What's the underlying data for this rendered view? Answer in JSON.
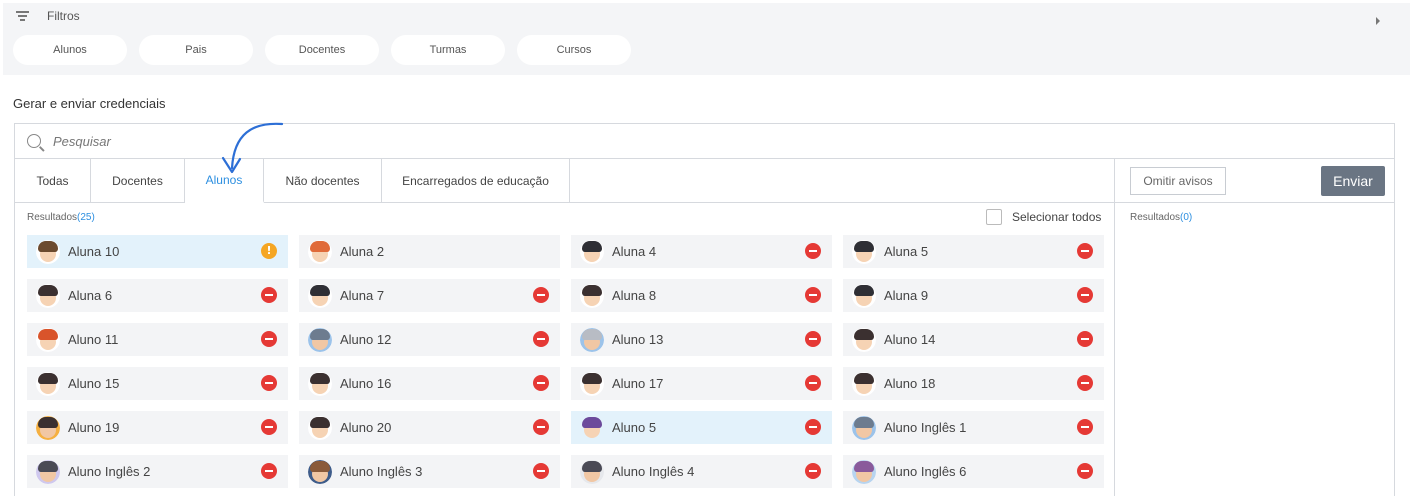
{
  "filters": {
    "title": "Filtros",
    "pills": [
      "Alunos",
      "Pais",
      "Docentes",
      "Turmas",
      "Cursos"
    ]
  },
  "section_title": "Gerar e enviar credenciais",
  "search": {
    "placeholder": "Pesquisar"
  },
  "tabs": [
    "Todas",
    "Docentes",
    "Alunos",
    "Não docentes",
    "Encarregados de educação"
  ],
  "active_tab": "Alunos",
  "left": {
    "results_label": "Resultados",
    "results_count": "(25)",
    "select_all_label": "Selecionar todos"
  },
  "right": {
    "omit_label": "Omitir avisos",
    "send_label": "Enviar",
    "results_label": "Resultados",
    "results_count": "(0)"
  },
  "accent_color": "#2d8fe0",
  "people": [
    {
      "name": "Aluna 10",
      "status": "warning",
      "highlight": true,
      "avatar": "boy-brown"
    },
    {
      "name": "Aluna 2",
      "status": "none",
      "highlight": false,
      "avatar": "girl-orange"
    },
    {
      "name": "Aluna 4",
      "status": "blocked",
      "highlight": false,
      "avatar": "girl-dark"
    },
    {
      "name": "Aluna 5",
      "status": "blocked",
      "highlight": false,
      "avatar": "girl-dark"
    },
    {
      "name": "Aluna 6",
      "status": "blocked",
      "highlight": false,
      "avatar": "boy-dark"
    },
    {
      "name": "Aluna 7",
      "status": "blocked",
      "highlight": false,
      "avatar": "girl-dark"
    },
    {
      "name": "Aluna 8",
      "status": "blocked",
      "highlight": false,
      "avatar": "girl-bun"
    },
    {
      "name": "Aluna 9",
      "status": "blocked",
      "highlight": false,
      "avatar": "girl-dark"
    },
    {
      "name": "Aluno 11",
      "status": "blocked",
      "highlight": false,
      "avatar": "boy-red"
    },
    {
      "name": "Aluno 12",
      "status": "blocked",
      "highlight": false,
      "avatar": "man-blue"
    },
    {
      "name": "Aluno 13",
      "status": "blocked",
      "highlight": false,
      "avatar": "old-blue"
    },
    {
      "name": "Aluno 14",
      "status": "blocked",
      "highlight": false,
      "avatar": "boy-dark"
    },
    {
      "name": "Aluno 15",
      "status": "blocked",
      "highlight": false,
      "avatar": "boy-dark"
    },
    {
      "name": "Aluno 16",
      "status": "blocked",
      "highlight": false,
      "avatar": "boy-dark"
    },
    {
      "name": "Aluno 17",
      "status": "blocked",
      "highlight": false,
      "avatar": "boy-dark"
    },
    {
      "name": "Aluno 18",
      "status": "blocked",
      "highlight": false,
      "avatar": "boy-dark"
    },
    {
      "name": "Aluno 19",
      "status": "blocked",
      "highlight": false,
      "avatar": "man-orange"
    },
    {
      "name": "Aluno 20",
      "status": "blocked",
      "highlight": false,
      "avatar": "boy-dark"
    },
    {
      "name": "Aluno 5",
      "status": "blocked",
      "highlight": true,
      "avatar": "girl-purple"
    },
    {
      "name": "Aluno Inglês 1",
      "status": "blocked",
      "highlight": false,
      "avatar": "man-blue"
    },
    {
      "name": "Aluno Inglês 2",
      "status": "blocked",
      "highlight": false,
      "avatar": "man-lavender"
    },
    {
      "name": "Aluno Inglês 3",
      "status": "blocked",
      "highlight": false,
      "avatar": "woman-navy"
    },
    {
      "name": "Aluno Inglês 4",
      "status": "blocked",
      "highlight": false,
      "avatar": "man-gray"
    },
    {
      "name": "Aluno Inglês 6",
      "status": "blocked",
      "highlight": false,
      "avatar": "woman-blue"
    }
  ],
  "icons": {
    "filter": "filter-icon",
    "caret": "caret-right-icon",
    "search": "search-icon",
    "warning": "warning-icon",
    "blocked": "blocked-icon",
    "arrow": "curved-arrow-icon"
  }
}
